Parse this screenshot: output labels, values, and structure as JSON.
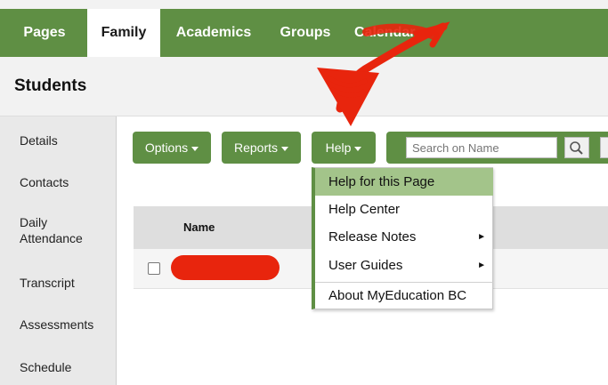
{
  "nav": {
    "tabs": [
      {
        "label": "Pages"
      },
      {
        "label": "Family"
      },
      {
        "label": "Academics"
      },
      {
        "label": "Groups"
      },
      {
        "label": "Calendar"
      }
    ],
    "active_tab": "Family"
  },
  "header": {
    "title": "Students"
  },
  "sidebar": {
    "items": [
      {
        "label": "Details"
      },
      {
        "label": "Contacts"
      },
      {
        "label": "Daily Attendance"
      },
      {
        "label": "Transcript"
      },
      {
        "label": "Assessments"
      },
      {
        "label": "Schedule"
      }
    ]
  },
  "toolbar": {
    "options_label": "Options",
    "reports_label": "Reports",
    "help_label": "Help",
    "search_placeholder": "Search on Name"
  },
  "table": {
    "columns": [
      "Name"
    ]
  },
  "help_menu": {
    "items": [
      {
        "label": "Help for this Page",
        "highlighted": true,
        "submenu": false
      },
      {
        "label": "Help Center",
        "highlighted": false,
        "submenu": false
      },
      {
        "label": "Release Notes",
        "highlighted": false,
        "submenu": true
      },
      {
        "label": "User Guides",
        "highlighted": false,
        "submenu": true
      },
      {
        "label": "About MyEducation BC",
        "highlighted": false,
        "submenu": false
      }
    ]
  },
  "colors": {
    "brand_green": "#5f8f44",
    "menu_highlight": "#a3c48a",
    "annotation_red": "#e8250d"
  },
  "icons": [
    "search-icon",
    "submenu-arrow-icon",
    "dropdown-caret-icon"
  ]
}
